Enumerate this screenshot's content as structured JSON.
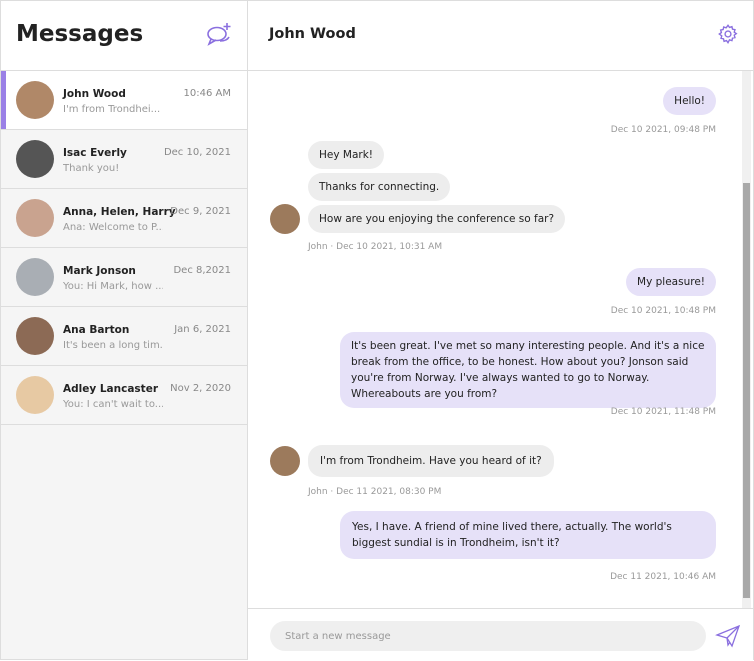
{
  "sidebar": {
    "title": "Messages",
    "new_chat_icon": "new-chat-icon",
    "conversations": [
      {
        "name": "John Wood",
        "time": "10:46 AM",
        "preview": "I'm from Trondhei...",
        "active": true,
        "avatar": "#b08868"
      },
      {
        "name": "Isac Everly",
        "time": "Dec 10, 2021",
        "preview": "Thank you!",
        "avatar": "#555555"
      },
      {
        "name": "Anna, Helen, Harry",
        "time": "Dec 9, 2021",
        "preview": "Ana: Welcome to P...",
        "avatar": "#c9a38f"
      },
      {
        "name": "Mark Jonson",
        "time": "Dec 8,2021",
        "preview": "You: Hi Mark, how ...",
        "avatar": "#a9aeb4"
      },
      {
        "name": "Ana Barton",
        "time": "Jan 6, 2021",
        "preview": "It's been a long tim...",
        "avatar": "#8c6a55"
      },
      {
        "name": "Adley Lancaster",
        "time": "Nov 2, 2020",
        "preview": "You: I can't wait to...",
        "avatar": "#e7c9a3"
      }
    ]
  },
  "chat": {
    "title": "John Wood",
    "settings_icon": "gear-icon",
    "messages": [
      {
        "text": "Hello!",
        "meta": "Dec 10 2021, 09:48 PM"
      },
      {
        "text": "Hey Mark!"
      },
      {
        "text": "Thanks for connecting."
      },
      {
        "text": "How are you enjoying the conference so far?",
        "meta": "John · Dec 10 2021, 10:31 AM"
      },
      {
        "text": "My pleasure!",
        "meta": "Dec 10 2021, 10:48 PM"
      },
      {
        "text": "It's been great. I've met so many interesting people. And it's a nice break from the office, to be honest. How about you? Jonson said you're from Norway. I've always wanted to go to Norway. Whereabouts are you from?",
        "meta": "Dec 10 2021, 11:48 PM"
      },
      {
        "text": "I'm from Trondheim. Have you heard of it?",
        "meta": "John · Dec 11 2021, 08:30 PM"
      },
      {
        "text": "Yes, I have. A friend of mine lived there, actually. The world's biggest sundial is in Trondheim, isn't it?",
        "meta": "Dec 11 2021, 10:46 AM"
      }
    ]
  },
  "composer": {
    "placeholder": "Start a new message",
    "send_icon": "send-icon"
  },
  "colors": {
    "accent": "#8a6fdf",
    "outgoing_bubble": "#e6e1f8",
    "incoming_bubble": "#ededed"
  }
}
